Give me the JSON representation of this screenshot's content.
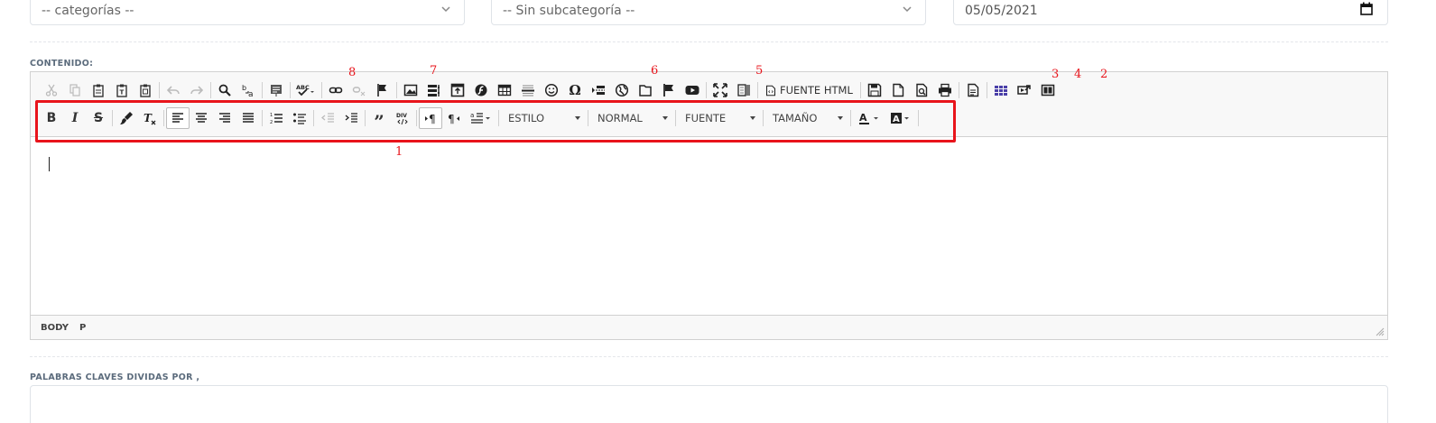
{
  "form": {
    "category_select": {
      "value": "-- categorías --"
    },
    "subcategory_select": {
      "value": "-- Sin subcategoría --"
    },
    "date_input": {
      "value": "05/05/2021"
    },
    "content_label": "CONTENIDO:",
    "keywords_label": "PALABRAS CLAVES DIVIDAS POR ,"
  },
  "editor": {
    "toolbar1": {
      "source_label": "FUENTE HTML"
    },
    "toolbar2": {
      "style_combo": "ESTILO",
      "format_combo": "NORMAL",
      "font_combo": "FUENTE",
      "size_combo": "TAMAÑO"
    },
    "statusbar": {
      "path": [
        "BODY",
        "P"
      ]
    }
  },
  "annotations": {
    "color": "#e8141b",
    "labels": [
      "1",
      "2",
      "3",
      "4",
      "5",
      "6",
      "7",
      "8"
    ]
  }
}
